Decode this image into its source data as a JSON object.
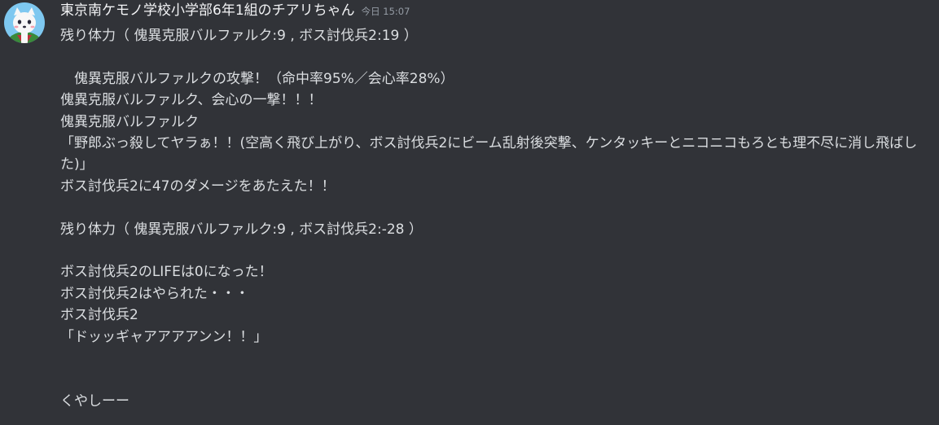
{
  "message": {
    "author": "東京南ケモノ学校小学部6年1組のチアリちゃん",
    "timestamp": "今日 15:07",
    "lines": [
      "残り体力（ 傀異克服バルファルク:9 , ボス討伐兵2:19 ）",
      "",
      "　傀異克服バルファルクの攻撃！（命中率95%／会心率28%）",
      "傀異克服バルファルク、会心の一撃！！！",
      "傀異克服バルファルク",
      "「野郎ぶっ殺してヤラぁ！！(空高く飛び上がり、ボス討伐兵2にビーム乱射後突撃、ケンタッキーとニコニコもろとも理不尽に消し飛ばした)」",
      "ボス討伐兵2に47のダメージをあたえた！！",
      "",
      "残り体力（ 傀異克服バルファルク:9 , ボス討伐兵2:-28 ）",
      "",
      "ボス討伐兵2のLIFEは0になった！",
      "ボス討伐兵2はやられた・・・",
      "ボス討伐兵2",
      "「ドッッギャアアアアンン！！」",
      "",
      "",
      "くやしーー"
    ]
  },
  "colors": {
    "background": "#313338",
    "text": "#dbdee1",
    "username": "#f2f3f5",
    "timestamp": "#949ba4"
  }
}
